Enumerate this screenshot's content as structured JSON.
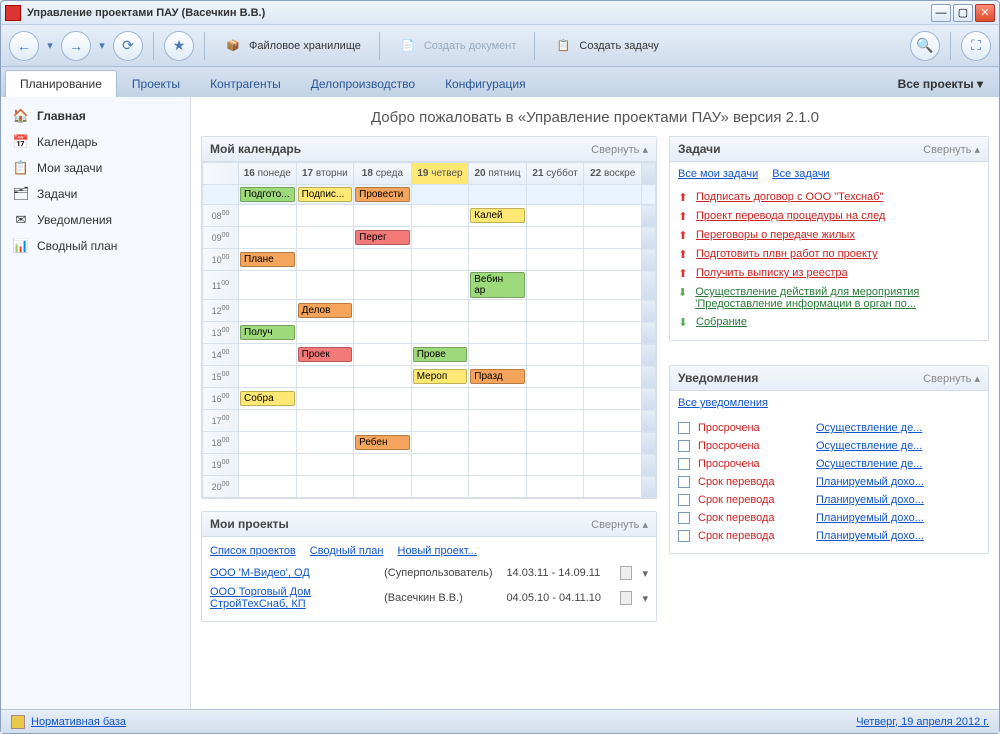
{
  "window": {
    "title": "Управление проектами ПАУ (Васечкин В.В.)"
  },
  "toolbar": {
    "file_storage": "Файловое хранилище",
    "create_doc": "Создать документ",
    "create_task": "Создать задачу"
  },
  "tabs": {
    "items": [
      {
        "label": "Планирование"
      },
      {
        "label": "Проекты"
      },
      {
        "label": "Контрагенты"
      },
      {
        "label": "Делопроизводство"
      },
      {
        "label": "Конфигурация"
      }
    ],
    "all_projects": "Все проекты ▾"
  },
  "sidebar": {
    "items": [
      {
        "label": "Главная"
      },
      {
        "label": "Календарь"
      },
      {
        "label": "Мои задачи"
      },
      {
        "label": "Задачи"
      },
      {
        "label": "Уведомления"
      },
      {
        "label": "Сводный план"
      }
    ]
  },
  "welcome": "Добро пожаловать в «Управление проектами ПАУ» версия 2.1.0",
  "calendar": {
    "title": "Мой календарь",
    "collapse": "Свернуть ▴",
    "days": [
      {
        "num": "16",
        "label": "понеде"
      },
      {
        "num": "17",
        "label": "вторни"
      },
      {
        "num": "18",
        "label": "среда"
      },
      {
        "num": "19",
        "label": "четвер"
      },
      {
        "num": "20",
        "label": "пятниц"
      },
      {
        "num": "21",
        "label": "суббот"
      },
      {
        "num": "22",
        "label": "воскре"
      }
    ],
    "allday": [
      {
        "col": 0,
        "label": "Подгото...",
        "color": "green"
      },
      {
        "col": 1,
        "label": "Подпис...",
        "color": "yellow"
      },
      {
        "col": 2,
        "label": "Провести",
        "color": "orange"
      }
    ],
    "hours": [
      "08",
      "09",
      "10",
      "11",
      "12",
      "13",
      "14",
      "15",
      "16",
      "17",
      "18",
      "19",
      "20"
    ],
    "events": {
      "08": [
        {
          "col": 4,
          "label": "Калей",
          "color": "yellow"
        }
      ],
      "09": [
        {
          "col": 2,
          "label": "Перег",
          "color": "red"
        }
      ],
      "10": [
        {
          "col": 0,
          "label": "Плане",
          "color": "orange"
        }
      ],
      "11": [
        {
          "col": 4,
          "label": "Вебин",
          "color": "green",
          "rowspan": 2,
          "label2": "ар"
        }
      ],
      "12": [
        {
          "col": 1,
          "label": "Делов",
          "color": "orange"
        }
      ],
      "13": [
        {
          "col": 0,
          "label": "Получ",
          "color": "green"
        }
      ],
      "14": [
        {
          "col": 1,
          "label": "Проек",
          "color": "red"
        },
        {
          "col": 3,
          "label": "Прове",
          "color": "green"
        }
      ],
      "15": [
        {
          "col": 3,
          "label": "Мероп",
          "color": "yellow"
        },
        {
          "col": 4,
          "label": "Празд",
          "color": "orange"
        }
      ],
      "16": [
        {
          "col": 0,
          "label": "Собра",
          "color": "yellow"
        }
      ],
      "18": [
        {
          "col": 2,
          "label": "Ребен",
          "color": "orange"
        }
      ]
    }
  },
  "projects_panel": {
    "title": "Мои проекты",
    "collapse": "Свернуть ▴",
    "links": {
      "list": "Список проектов",
      "plan": "Сводный план",
      "new": "Новый проект..."
    },
    "rows": [
      {
        "name": "ООО 'М-Видео', ОД",
        "meta": "(Суперпользователь)",
        "dates": "14.03.11 - 14.09.11"
      },
      {
        "name": "ООО Торговый Дом СтройТехСнаб, КП",
        "meta": "(Васечкин В.В.)",
        "dates": "04.05.10 - 04.11.10"
      }
    ]
  },
  "tasks_panel": {
    "title": "Задачи",
    "collapse": "Свернуть ▴",
    "links": {
      "mine": "Все мои задачи",
      "all": "Все задачи"
    },
    "items": [
      {
        "dir": "up",
        "label": "Подписать договор с ООО \"Техснаб\""
      },
      {
        "dir": "up",
        "label": "Проект перевода процедуры на след"
      },
      {
        "dir": "up",
        "label": "Переговоры о передаче жилых"
      },
      {
        "dir": "up",
        "label": "Подготовить плвн работ по проекту"
      },
      {
        "dir": "up",
        "label": "Получить выписку из реестра"
      },
      {
        "dir": "down",
        "label": "Осуществление действий для мероприятия 'Предоставление информации в орган по...",
        "green": true
      },
      {
        "dir": "down",
        "label": "Собрание",
        "green": true
      }
    ]
  },
  "notif_panel": {
    "title": "Уведомления",
    "collapse": "Свернуть ▴",
    "all": "Все уведомления",
    "rows": [
      {
        "left": "Просрочена",
        "right": "Осуществление де..."
      },
      {
        "left": "Просрочена",
        "right": "Осуществление де..."
      },
      {
        "left": "Просрочена",
        "right": "Осуществление де..."
      },
      {
        "left": "Срок перевода",
        "right": "Планируемый дохо..."
      },
      {
        "left": "Срок перевода",
        "right": "Планируемый дохо..."
      },
      {
        "left": "Срок перевода",
        "right": "Планируемый дохо..."
      },
      {
        "left": "Срок перевода",
        "right": "Планируемый дохо..."
      }
    ]
  },
  "status": {
    "norm": "Нормативная база",
    "date": "Четверг, 19 апреля 2012 г."
  }
}
